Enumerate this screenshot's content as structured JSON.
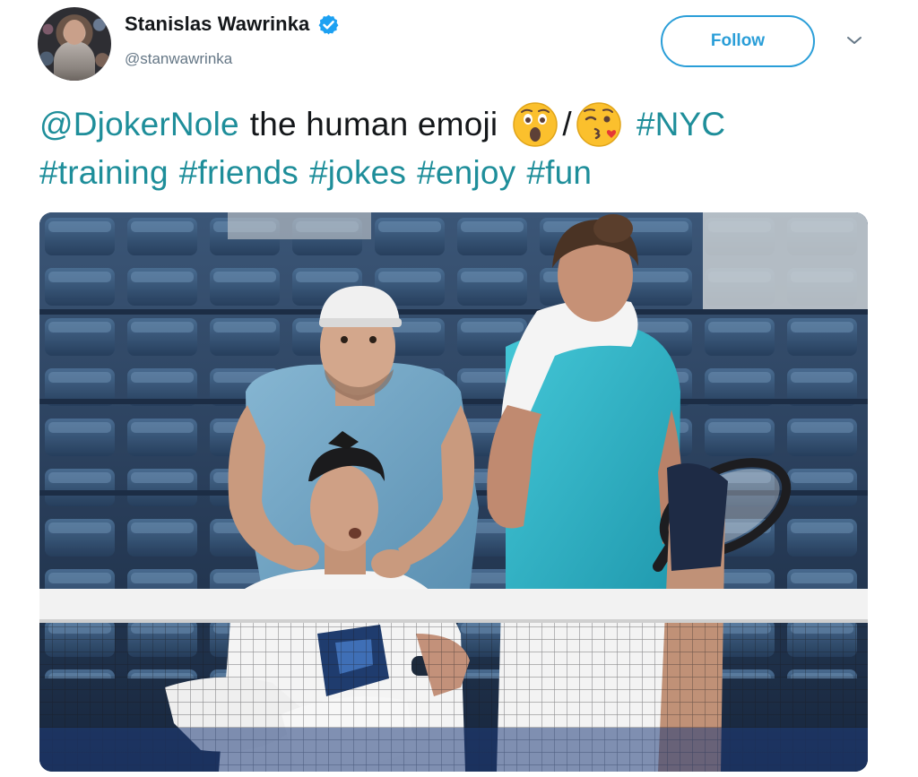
{
  "header": {
    "display_name": "Stanislas Wawrinka",
    "handle": "@stanwawrinka",
    "follow_label": "Follow",
    "avatar_icon": "user-avatar",
    "verified_icon": "verified-badge-icon",
    "more_icon": "chevron-down-icon"
  },
  "tweet": {
    "mention": "@DjokerNole",
    "text_main": "the human emoji",
    "emoji_1": "astonished-face-emoji",
    "separator": "/",
    "emoji_2": "face-blowing-kiss-emoji",
    "hashtag_nyc": "#NYC",
    "hashtags": [
      "#training",
      "#friends",
      "#jokes",
      "#enjoy",
      "#fun"
    ]
  },
  "media": {
    "description_icon": "tennis-training-photo",
    "colors": {
      "stadium_seats": "#2f4a6d",
      "net": "#f2f2f2",
      "shirt_turquoise": "#2bb3c6",
      "shirt_grey_blue": "#6ea2c3"
    }
  },
  "colors": {
    "accent": "#1e8e9a",
    "follow": "#2a9ed8",
    "verified": "#1da1f2",
    "text": "#14171a",
    "muted": "#657786"
  }
}
